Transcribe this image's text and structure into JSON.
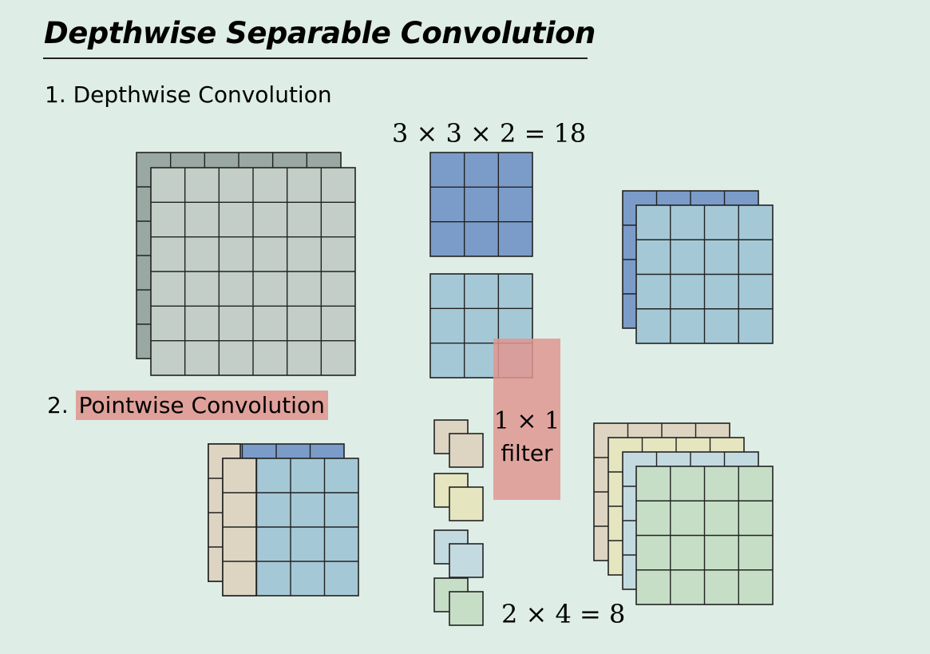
{
  "title": "Depthwise Separable Convolution",
  "step1": "1. Depthwise Convolution",
  "step2_number": "2.",
  "step2_label": "Pointwise Convolution",
  "depthwise_params": "3 × 3 × 2 = 18",
  "pointwise_params": "2 × 4 = 8",
  "filter_size": "1 × 1",
  "filter_word": "filter",
  "colors": {
    "background": "#deede6",
    "input_gray": "#c2cec7",
    "input_gray_back": "#9aa8a3",
    "kernel_dark_blue": "#7b9cc8",
    "kernel_light_blue": "#a5c8d6",
    "beige": "#ddd5c2",
    "yellow": "#e5e5c0",
    "pale_blue": "#c3dae0",
    "green": "#c6dec6",
    "highlight": "#e0a19b"
  }
}
